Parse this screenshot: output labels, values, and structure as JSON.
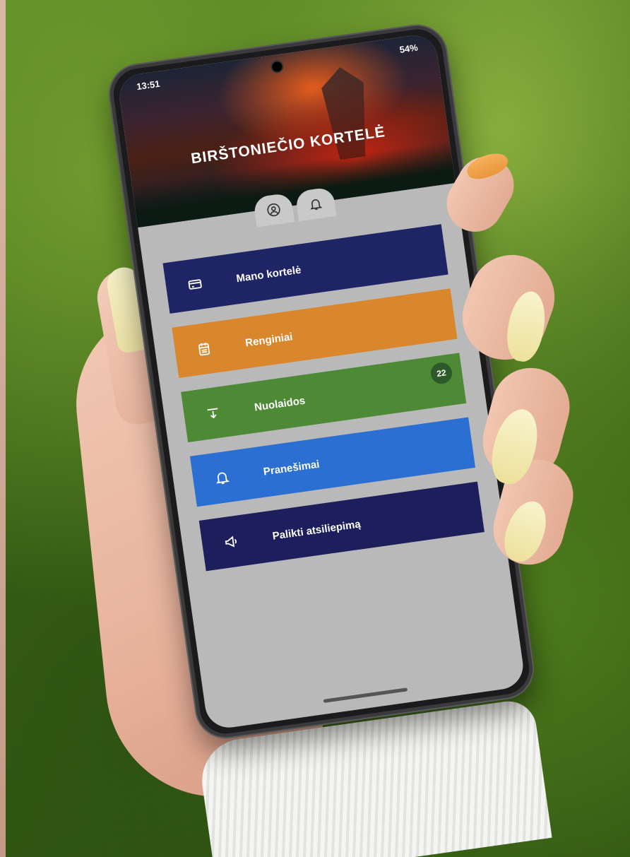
{
  "status_bar": {
    "time": "13:51",
    "battery": "54%"
  },
  "app": {
    "title": "BIRŠTONIEČIO KORTELĖ"
  },
  "header_tabs": [
    {
      "icon": "user-circle-icon"
    },
    {
      "icon": "bell-icon"
    }
  ],
  "menu": [
    {
      "label": "Mano kortelė",
      "color": "#1e2466",
      "icon": "card-icon"
    },
    {
      "label": "Renginiai",
      "color": "#d9862c",
      "icon": "calendar-icon"
    },
    {
      "label": "Nuolaidos",
      "color": "#4e8a36",
      "icon": "discount-icon",
      "badge": "22"
    },
    {
      "label": "Pranešimai",
      "color": "#2a6fd1",
      "icon": "bell-icon"
    },
    {
      "label": "Palikti atsiliepimą",
      "color": "#1c1f5c",
      "icon": "megaphone-icon"
    }
  ]
}
